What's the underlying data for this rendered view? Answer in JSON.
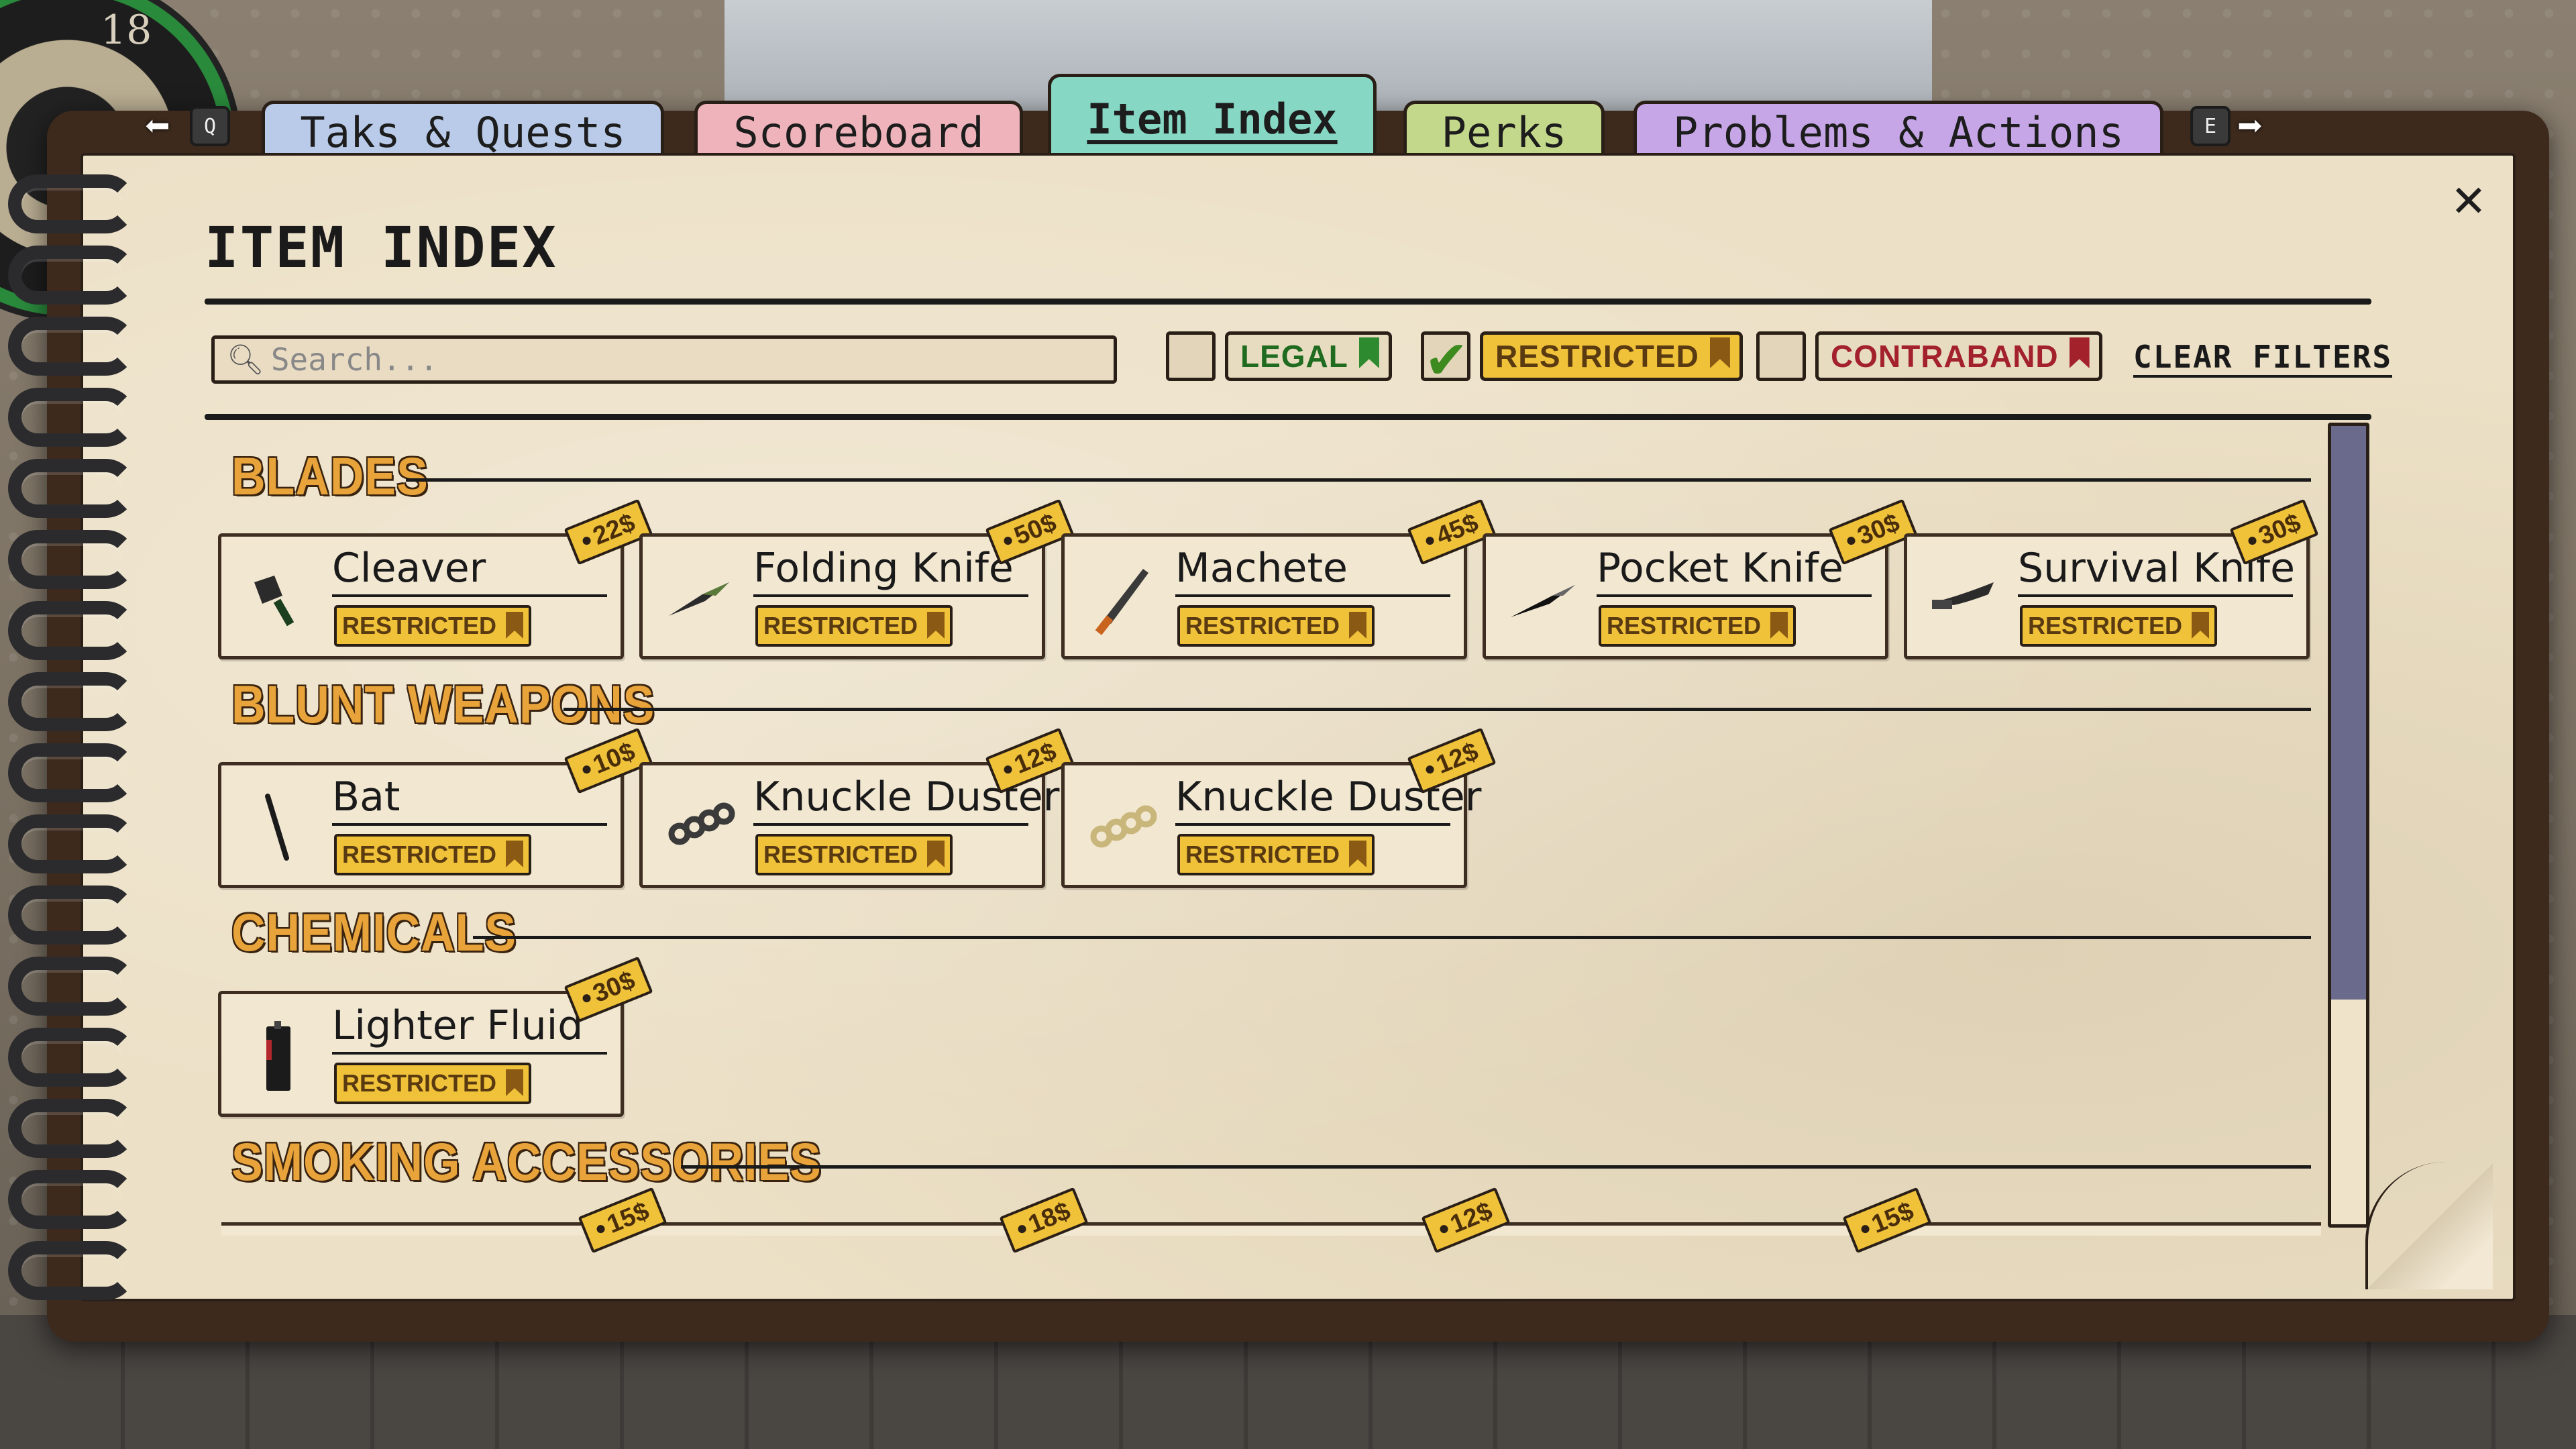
{
  "background": {
    "dartboard_number": "18"
  },
  "tabs": {
    "prev_key": "Q",
    "next_key": "E",
    "items": [
      {
        "label": "Taks & Quests",
        "color": "#b9cbe8"
      },
      {
        "label": "Scoreboard",
        "color": "#efb4bb"
      },
      {
        "label": "Item Index",
        "color": "#86d7c4",
        "active": true
      },
      {
        "label": "Perks",
        "color": "#c4d88b"
      },
      {
        "label": "Problems & Actions",
        "color": "#c6a6e6"
      }
    ]
  },
  "page": {
    "title": "ITEM INDEX",
    "close_icon": "close-icon"
  },
  "search": {
    "placeholder": "Search...",
    "value": ""
  },
  "filters": {
    "legal": {
      "label": "LEGAL",
      "checked": false,
      "text_color": "#1f6b1f",
      "bg": "#e7dcc0",
      "flag_color": "#2e8a2e"
    },
    "restricted": {
      "label": "RESTRICTED",
      "checked": true,
      "text_color": "#5a3a10",
      "bg": "#f0c23a",
      "flag_color": "#8a5a14"
    },
    "contraband": {
      "label": "CONTRABAND",
      "checked": false,
      "text_color": "#a3212b",
      "bg": "#e7dcc0",
      "flag_color": "#a3212b"
    },
    "clear_label": "CLEAR FILTERS"
  },
  "sections": [
    {
      "title": "BLADES",
      "items": [
        {
          "name": "Cleaver",
          "status": "RESTRICTED",
          "price": "22$",
          "icon": "cleaver-icon"
        },
        {
          "name": "Folding Knife",
          "status": "RESTRICTED",
          "price": "50$",
          "icon": "folding-knife-icon"
        },
        {
          "name": "Machete",
          "status": "RESTRICTED",
          "price": "45$",
          "icon": "machete-icon"
        },
        {
          "name": "Pocket Knife",
          "status": "RESTRICTED",
          "price": "30$",
          "icon": "pocket-knife-icon"
        },
        {
          "name": "Survival Knife",
          "status": "RESTRICTED",
          "price": "30$",
          "icon": "survival-knife-icon"
        }
      ]
    },
    {
      "title": "BLUNT WEAPONS",
      "items": [
        {
          "name": "Bat",
          "status": "RESTRICTED",
          "price": "10$",
          "icon": "bat-icon"
        },
        {
          "name": "Knuckle Duster",
          "status": "RESTRICTED",
          "price": "12$",
          "icon": "knuckle-duster-icon"
        },
        {
          "name": "Knuckle Duster",
          "status": "RESTRICTED",
          "price": "12$",
          "icon": "gold-knuckle-duster-icon"
        }
      ]
    },
    {
      "title": "CHEMICALS",
      "items": [
        {
          "name": "Lighter Fluid",
          "status": "RESTRICTED",
          "price": "30$",
          "icon": "lighter-fluid-icon"
        }
      ]
    },
    {
      "title": "SMOKING ACCESSORIES",
      "partial_prices": [
        "15$",
        "18$",
        "12$",
        "15$"
      ]
    }
  ],
  "scrollbar": {
    "position": 0.0
  }
}
